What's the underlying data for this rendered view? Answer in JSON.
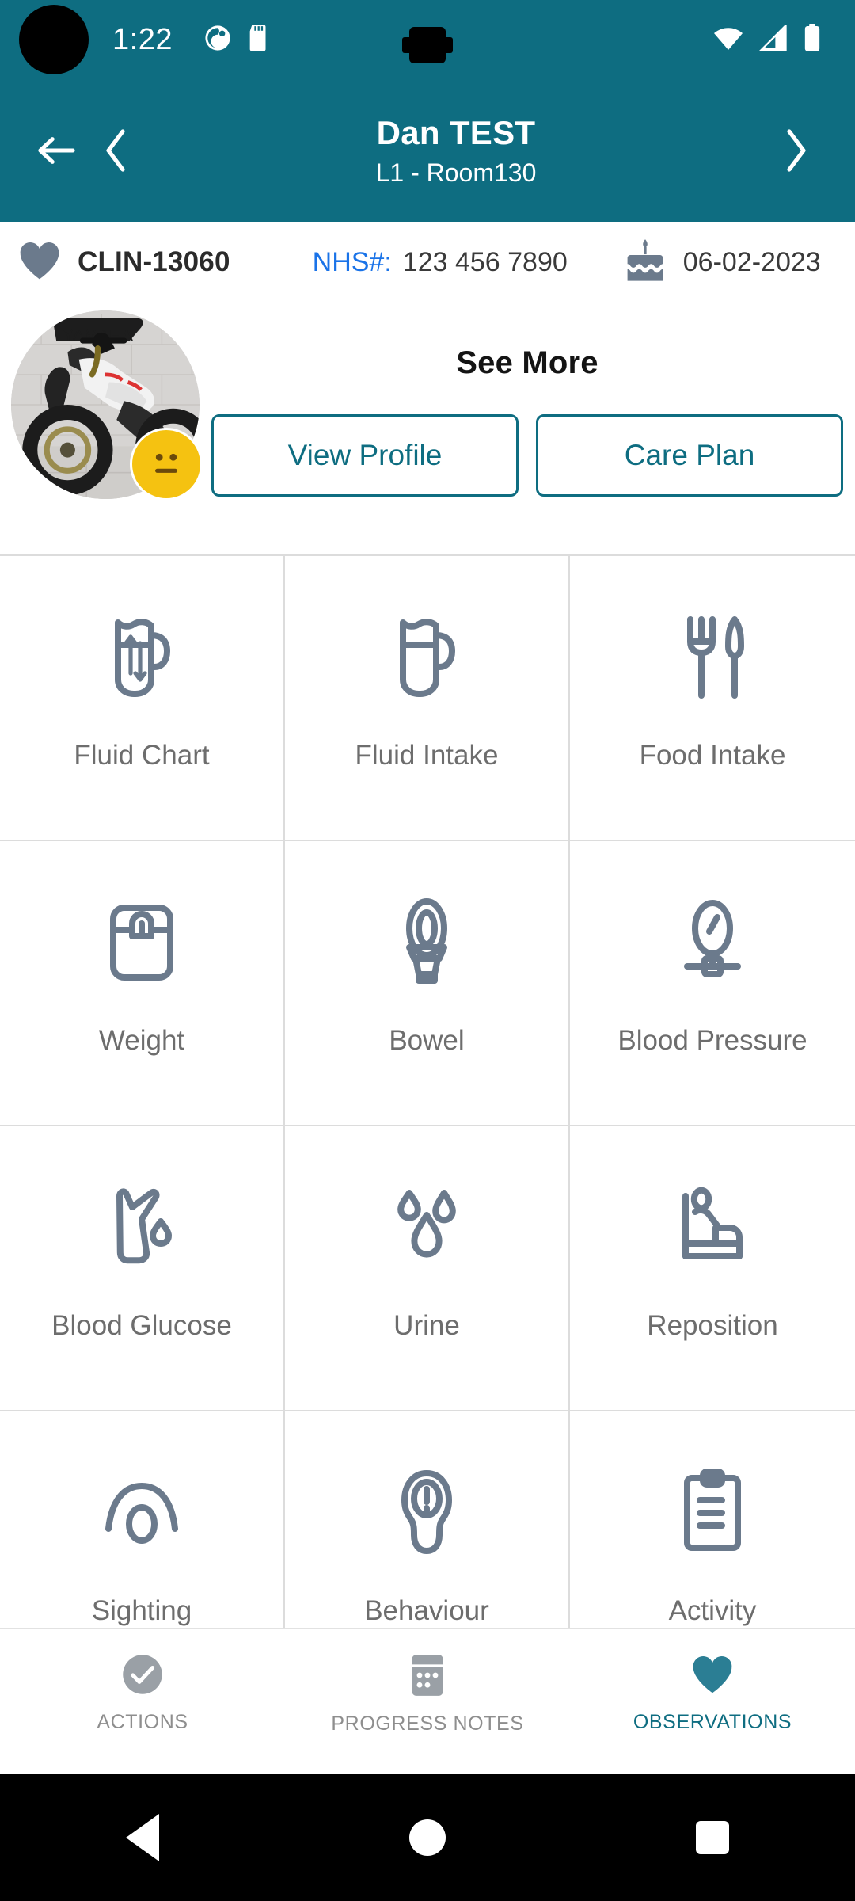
{
  "statusbar": {
    "time": "1:22",
    "icons": [
      "app-notification-icon",
      "sd-card-icon"
    ],
    "right_icons": [
      "wifi-icon",
      "cellular-signal-icon",
      "battery-icon"
    ],
    "background_color": "#0E6D81"
  },
  "header": {
    "title": "Dan TEST",
    "subtitle": "L1 - Room130",
    "back_icon": "arrow-left-icon",
    "prev_icon": "chevron-left-icon",
    "next_icon": "chevron-right-icon",
    "background_color": "#0E6D81"
  },
  "info_bar": {
    "heart_icon": "heart-icon",
    "client_id": "CLIN-13060",
    "nhs_label": "NHS#:",
    "nhs_number": "123 456 7890",
    "cake_icon": "birthday-cake-icon",
    "date_of_birth": "06-02-2023",
    "nhs_label_color": "#1a73e8"
  },
  "profile": {
    "avatar_alt": "motorcycle-photo",
    "mood_badge": "neutral-face-emoji",
    "mood_color": "#F5C211",
    "see_more_label": "See More",
    "buttons": [
      {
        "label": "View Profile",
        "name": "view-profile-button"
      },
      {
        "label": "Care Plan",
        "name": "care-plan-button"
      }
    ],
    "accent_color": "#0E6D81"
  },
  "observations_grid": {
    "items": [
      {
        "label": "Fluid Chart",
        "icon": "pitcher-arrows-icon"
      },
      {
        "label": "Fluid Intake",
        "icon": "pitcher-icon"
      },
      {
        "label": "Food Intake",
        "icon": "fork-knife-icon"
      },
      {
        "label": "Weight",
        "icon": "weight-scale-icon"
      },
      {
        "label": "Bowel",
        "icon": "toilet-icon"
      },
      {
        "label": "Blood Pressure",
        "icon": "blood-pressure-gauge-icon"
      },
      {
        "label": "Blood Glucose",
        "icon": "hand-blood-drop-icon"
      },
      {
        "label": "Urine",
        "icon": "water-drops-icon"
      },
      {
        "label": "Reposition",
        "icon": "person-in-bed-icon"
      },
      {
        "label": "Sighting",
        "icon": "eye-icon"
      },
      {
        "label": "Behaviour",
        "icon": "head-exclamation-icon"
      },
      {
        "label": "Activity",
        "icon": "clipboard-icon"
      }
    ],
    "icon_color": "#6B7A8C",
    "label_color": "#6d6d6d"
  },
  "bottom_nav": {
    "items": [
      {
        "label": "ACTIONS",
        "icon": "check-circle-icon",
        "active": false
      },
      {
        "label": "PROGRESS NOTES",
        "icon": "notes-icon",
        "active": false
      },
      {
        "label": "OBSERVATIONS",
        "icon": "heart-icon",
        "active": true
      }
    ],
    "active_color": "#0E6D81",
    "inactive_color": "#9aa0a6"
  },
  "system_nav": {
    "back": "android-back-button",
    "home": "android-home-button",
    "recents": "android-recents-button"
  }
}
